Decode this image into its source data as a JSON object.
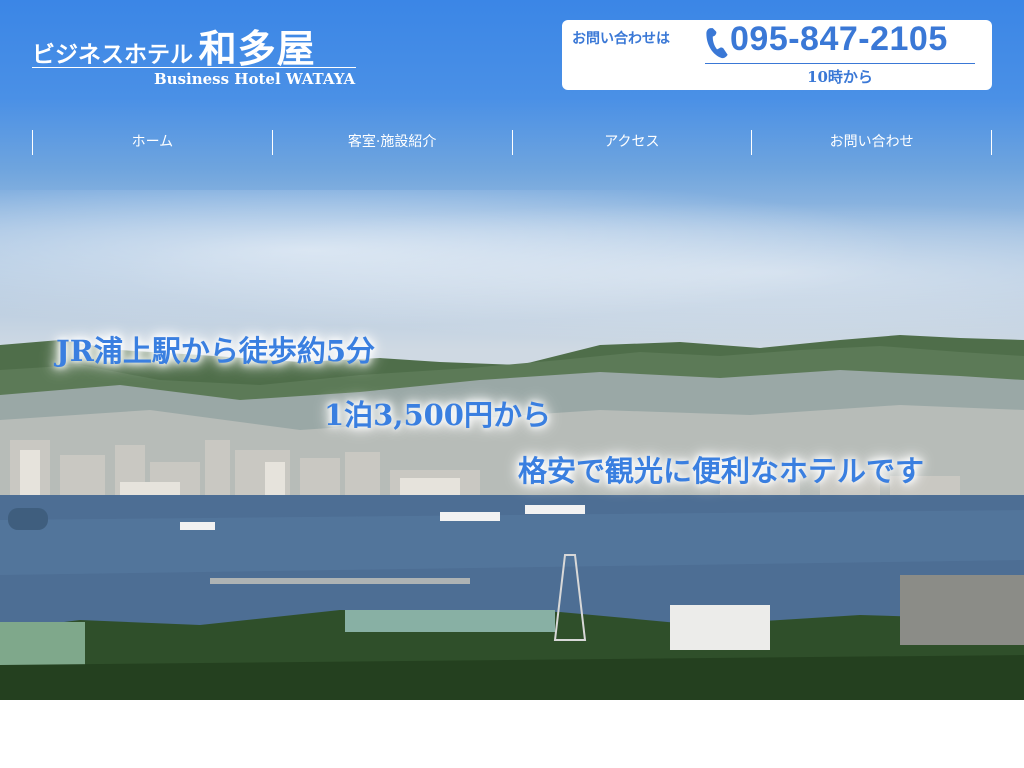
{
  "header": {
    "logo_small": "ビジネスホテル",
    "logo_big": "和多屋",
    "logo_en": "Business Hotel WATAYA"
  },
  "contact": {
    "label": "お問い合わせは",
    "phone": "095-847-2105",
    "hours": "10時から",
    "icon": "phone-icon"
  },
  "nav": {
    "items": [
      {
        "label": "ホーム"
      },
      {
        "label": "客室·施設紹介"
      },
      {
        "label": "アクセス"
      },
      {
        "label": "お問い合わせ"
      }
    ]
  },
  "hero": {
    "line1": "JR浦上駅から徒歩約5分",
    "line2": "1泊3,500円から",
    "line3": "格安で観光に便利なホテルです"
  },
  "colors": {
    "accent": "#3a78d6",
    "sky": "#3b86e6",
    "white": "#ffffff"
  }
}
